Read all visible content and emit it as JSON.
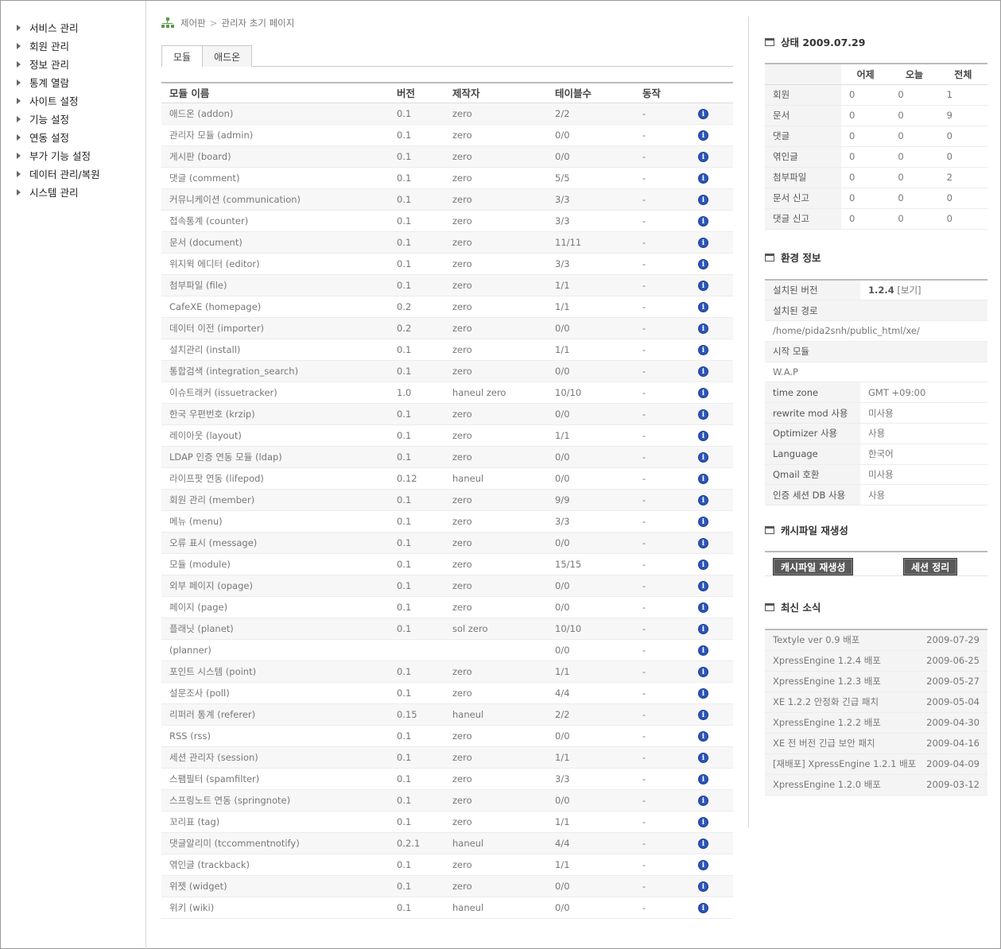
{
  "sidebar": {
    "items": [
      "서비스 관리",
      "회원 관리",
      "정보 관리",
      "통계 열람",
      "사이트 설정",
      "기능 설정",
      "연동 설정",
      "부가 기능 설정",
      "데이터 관리/복원",
      "시스템 관리"
    ]
  },
  "breadcrumb": {
    "root": "제어판",
    "separator": ">",
    "current": "관리자 초기 페이지"
  },
  "tabs": [
    "모듈",
    "애드온"
  ],
  "modules": {
    "headers": [
      "모듈 이름",
      "버전",
      "제작자",
      "테이블수",
      "동작"
    ],
    "rows": [
      [
        "애드온 (addon)",
        "0.1",
        "zero",
        "2/2",
        "-"
      ],
      [
        "관리자 모듈 (admin)",
        "0.1",
        "zero",
        "0/0",
        "-"
      ],
      [
        "게시판 (board)",
        "0.1",
        "zero",
        "0/0",
        "-"
      ],
      [
        "댓글 (comment)",
        "0.1",
        "zero",
        "5/5",
        "-"
      ],
      [
        "커뮤니케이션 (communication)",
        "0.1",
        "zero",
        "3/3",
        "-"
      ],
      [
        "접속통계 (counter)",
        "0.1",
        "zero",
        "3/3",
        "-"
      ],
      [
        "문서 (document)",
        "0.1",
        "zero",
        "11/11",
        "-"
      ],
      [
        "위지윅 에디터 (editor)",
        "0.1",
        "zero",
        "3/3",
        "-"
      ],
      [
        "첨부파일 (file)",
        "0.1",
        "zero",
        "1/1",
        "-"
      ],
      [
        "CafeXE (homepage)",
        "0.2",
        "zero",
        "1/1",
        "-"
      ],
      [
        "데이터 이전 (importer)",
        "0.2",
        "zero",
        "0/0",
        "-"
      ],
      [
        "설치관리 (install)",
        "0.1",
        "zero",
        "1/1",
        "-"
      ],
      [
        "통합검색 (integration_search)",
        "0.1",
        "zero",
        "0/0",
        "-"
      ],
      [
        "이슈트래커 (issuetracker)",
        "1.0",
        "haneul zero",
        "10/10",
        "-"
      ],
      [
        "한국 우편번호 (krzip)",
        "0.1",
        "zero",
        "0/0",
        "-"
      ],
      [
        "레이아웃 (layout)",
        "0.1",
        "zero",
        "1/1",
        "-"
      ],
      [
        "LDAP 인증 연동 모듈 (ldap)",
        "0.1",
        "zero",
        "0/0",
        "-"
      ],
      [
        "라이프팟 연동 (lifepod)",
        "0.12",
        "haneul",
        "0/0",
        "-"
      ],
      [
        "회원 관리 (member)",
        "0.1",
        "zero",
        "9/9",
        "-"
      ],
      [
        "메뉴 (menu)",
        "0.1",
        "zero",
        "3/3",
        "-"
      ],
      [
        "오류 표시 (message)",
        "0.1",
        "zero",
        "0/0",
        "-"
      ],
      [
        "모듈 (module)",
        "0.1",
        "zero",
        "15/15",
        "-"
      ],
      [
        "외부 페이지 (opage)",
        "0.1",
        "zero",
        "0/0",
        "-"
      ],
      [
        "페이지 (page)",
        "0.1",
        "zero",
        "0/0",
        "-"
      ],
      [
        "플래닛 (planet)",
        "0.1",
        "sol zero",
        "10/10",
        "-"
      ],
      [
        "(planner)",
        "",
        "",
        "0/0",
        "-"
      ],
      [
        "포인트 시스템 (point)",
        "0.1",
        "zero",
        "1/1",
        "-"
      ],
      [
        "설문조사 (poll)",
        "0.1",
        "zero",
        "4/4",
        "-"
      ],
      [
        "리퍼러 통계 (referer)",
        "0.15",
        "haneul",
        "2/2",
        "-"
      ],
      [
        "RSS (rss)",
        "0.1",
        "zero",
        "0/0",
        "-"
      ],
      [
        "세션 관리자 (session)",
        "0.1",
        "zero",
        "1/1",
        "-"
      ],
      [
        "스팸필터 (spamfilter)",
        "0.1",
        "zero",
        "3/3",
        "-"
      ],
      [
        "스프링노트 연동 (springnote)",
        "0.1",
        "zero",
        "0/0",
        "-"
      ],
      [
        "꼬리표 (tag)",
        "0.1",
        "zero",
        "1/1",
        "-"
      ],
      [
        "댓글알리미 (tccommentnotify)",
        "0.2.1",
        "haneul",
        "4/4",
        "-"
      ],
      [
        "엮인글 (trackback)",
        "0.1",
        "zero",
        "1/1",
        "-"
      ],
      [
        "위젯 (widget)",
        "0.1",
        "zero",
        "0/0",
        "-"
      ],
      [
        "위키 (wiki)",
        "0.1",
        "haneul",
        "0/0",
        "-"
      ]
    ],
    "info_glyph": "i"
  },
  "status": {
    "title": "상태 2009.07.29",
    "headers": [
      "어제",
      "오늘",
      "전체"
    ],
    "rows": [
      [
        "회원",
        "0",
        "0",
        "1"
      ],
      [
        "문서",
        "0",
        "0",
        "9"
      ],
      [
        "댓글",
        "0",
        "0",
        "0"
      ],
      [
        "엮인글",
        "0",
        "0",
        "0"
      ],
      [
        "첨부파일",
        "0",
        "0",
        "2"
      ],
      [
        "문서 신고",
        "0",
        "0",
        "0"
      ],
      [
        "댓글 신고",
        "0",
        "0",
        "0"
      ]
    ]
  },
  "env": {
    "title": "환경 정보",
    "version_label": "설치된 버전",
    "version_value": "1.2.4",
    "version_link": "[보기]",
    "path_label": "설치된 경로",
    "path_value": "/home/pida2snh/public_html/xe/",
    "start_label": "시작 모듈",
    "start_value": "W.A.P",
    "rows": [
      [
        "time zone",
        "GMT +09:00"
      ],
      [
        "rewrite mod 사용",
        "미사용"
      ],
      [
        "Optimizer 사용",
        "사용"
      ],
      [
        "Language",
        "한국어"
      ],
      [
        "Qmail 호환",
        "미사용"
      ],
      [
        "인증 세션 DB 사용",
        "사용"
      ]
    ]
  },
  "cache": {
    "title": "캐시파일 재생성",
    "regen_button": "캐시파일 재생성",
    "session_button": "세션 정리"
  },
  "news": {
    "title": "최신 소식",
    "items": [
      [
        "Textyle ver 0.9 배포",
        "2009-07-29"
      ],
      [
        "XpressEngine 1.2.4 배포",
        "2009-06-25"
      ],
      [
        "XpressEngine 1.2.3 배포",
        "2009-05-27"
      ],
      [
        "XE 1.2.2 안정화 긴급 패치",
        "2009-05-04"
      ],
      [
        "XpressEngine 1.2.2 배포",
        "2009-04-30"
      ],
      [
        "XE 전 버전 긴급 보안 패치",
        "2009-04-16"
      ],
      [
        "[재배포] XpressEngine 1.2.1 배포",
        "2009-04-09"
      ],
      [
        "XpressEngine 1.2.0 배포",
        "2009-03-12"
      ]
    ]
  },
  "colors": {
    "info_icon": "#2b55b8",
    "button_dark": "#5a5a5a",
    "sitemap_icon": "#5a9a4a"
  }
}
